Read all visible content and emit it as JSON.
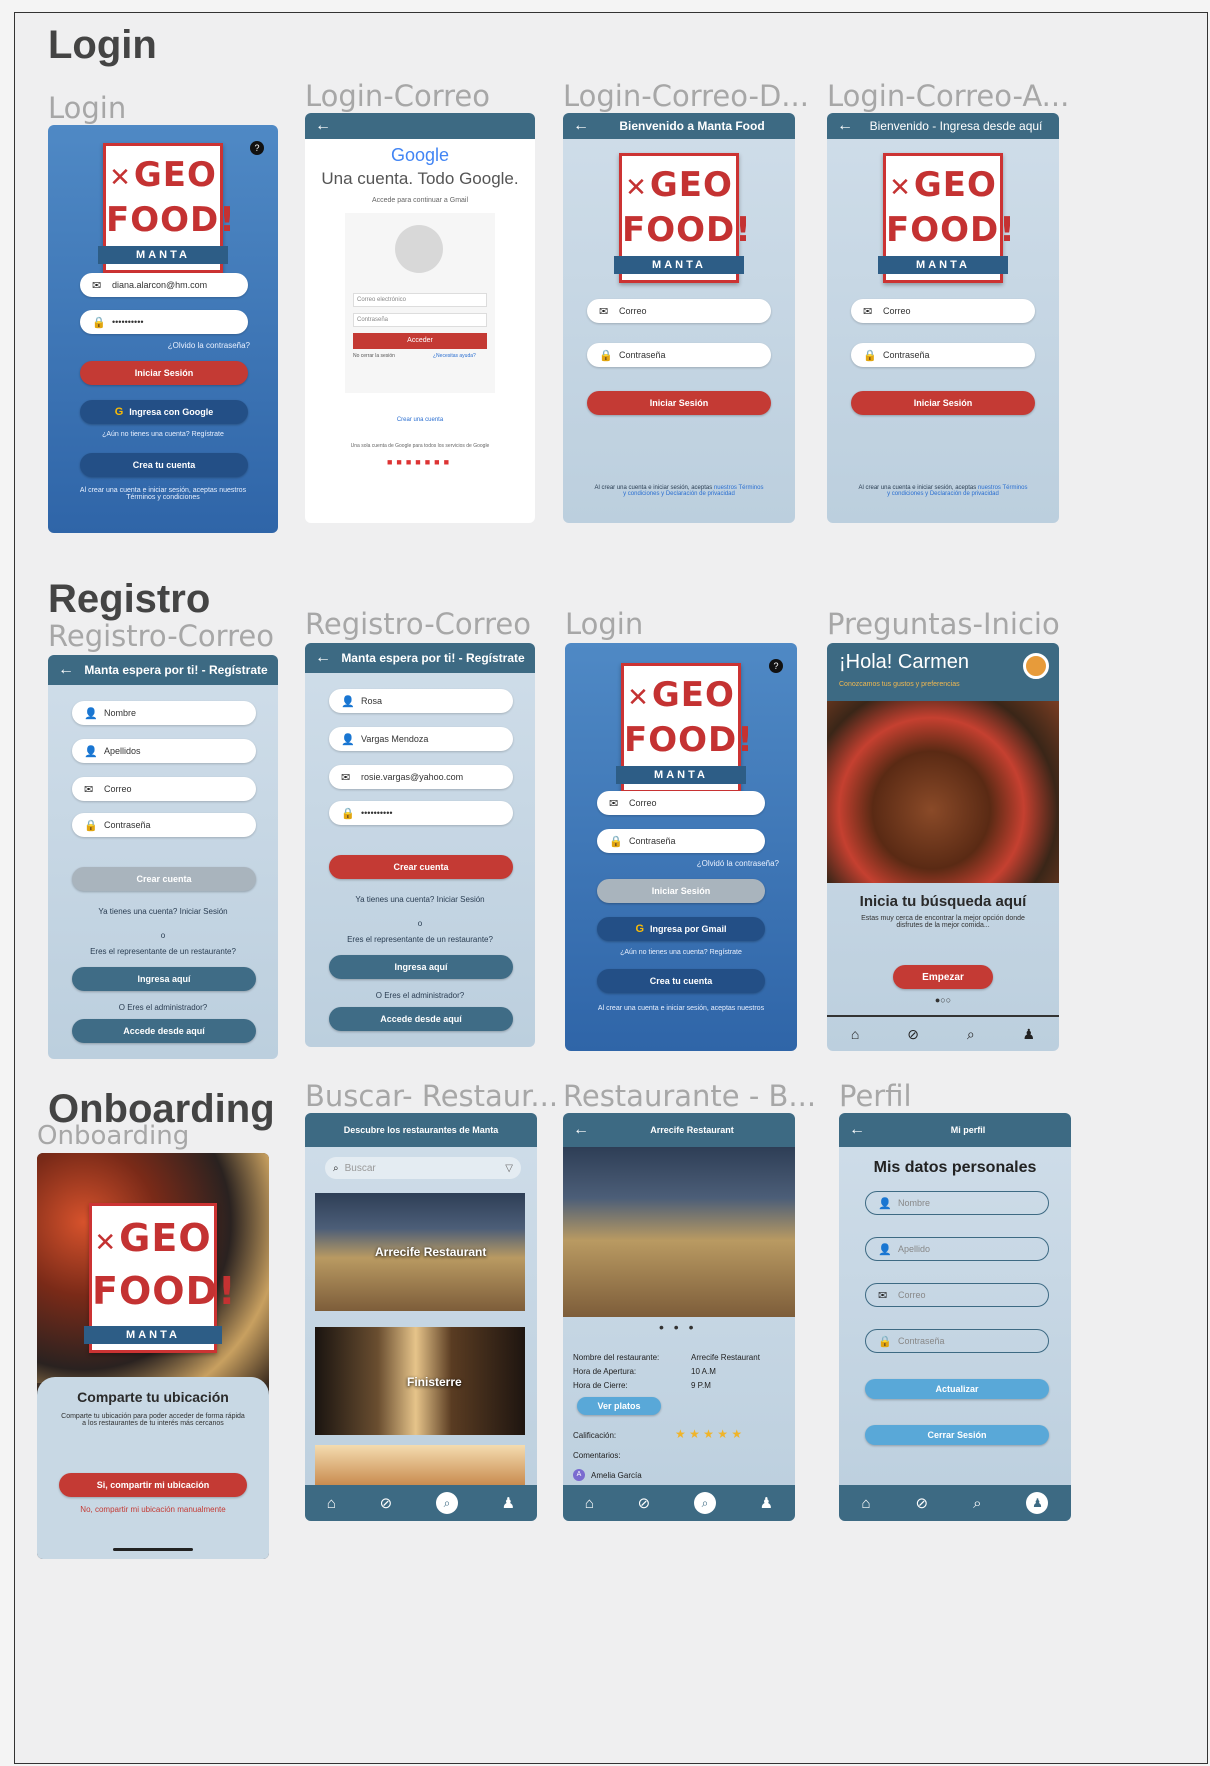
{
  "sections": {
    "login": "Login",
    "registro": "Registro",
    "onboarding": "Onboarding"
  },
  "frame_titles": {
    "login": "Login",
    "login_correo": "Login-Correo",
    "login_correo_d": "Login-Correo-D...",
    "login_correo_a": "Login-Correo-A...",
    "registro_correo_1": "Registro-Correo",
    "registro_correo_2": "Registro-Correo",
    "login_2": "Login",
    "preguntas": "Preguntas-Inicio",
    "onboarding": "Onboarding",
    "buscar": "Buscar- Restaur...",
    "restaurante": "Restaurante - B...",
    "perfil": "Perfil"
  },
  "logo": {
    "line1": "GEO",
    "line2": "FOOD!",
    "band": "MANTA"
  },
  "login1": {
    "email": "diana.alarcon@hm.com",
    "password": "••••••••••",
    "forgot": "¿Olvido la contraseña?",
    "signin": "Iniciar Sesión",
    "google": "Ingresa con Google",
    "register_hint": "¿Aún no tienes una cuenta? Regístrate",
    "create": "Crea tu cuenta",
    "terms": "Al crear una cuenta e iniciar sesión, aceptas nuestros Términos y condiciones"
  },
  "google": {
    "brand": "Google",
    "headline": "Una cuenta. Todo Google.",
    "sub": "Accede para continuar a Gmail",
    "email_ph": "Correo electrónico",
    "pass_ph": "Contraseña",
    "signin": "Acceder",
    "stay": "No cerrar la sesión",
    "help": "¿Necesitas ayuda?",
    "create": "Crear una cuenta",
    "footer": "Una sola cuenta de Google para todos los servicios de Google"
  },
  "login_d": {
    "header": "Bienvenido a Manta Food",
    "email_ph": "Correo",
    "pass_ph": "Contraseña",
    "signin": "Iniciar Sesión",
    "terms1": "Al crear una cuenta e iniciar sesión, aceptas",
    "terms2": "nuestros Términos",
    "terms3": "y condiciones y Declaración de privacidad"
  },
  "login_a": {
    "header": "Bienvenido - Ingresa desde aquí",
    "email_ph": "Correo",
    "pass_ph": "Contraseña",
    "signin": "Iniciar Sesión",
    "terms1": "Al crear una cuenta e iniciar sesión, aceptas",
    "terms2": "nuestros Términos",
    "terms3": "y condiciones y Declaración de privacidad"
  },
  "reg1": {
    "header": "Manta espera por ti! - Regístrate",
    "name_ph": "Nombre",
    "last_ph": "Apellidos",
    "email_ph": "Correo",
    "pass_ph": "Contraseña",
    "create": "Crear cuenta",
    "have": "Ya tienes una cuenta? Iniciar Sesión",
    "or": "o",
    "rep": "Eres el representante de un restaurante?",
    "enter": "Ingresa aquí",
    "admin": "O Eres el administrador?",
    "admin_btn": "Accede desde aquí"
  },
  "reg2": {
    "header": "Manta espera por ti! - Regístrate",
    "name": "Rosa",
    "last": "Vargas Mendoza",
    "email": "rosie.vargas@yahoo.com",
    "pass": "••••••••••",
    "create": "Crear cuenta",
    "have": "Ya tienes una cuenta? Iniciar Sesión",
    "or": "o",
    "rep": "Eres el representante de un restaurante?",
    "enter": "Ingresa aquí",
    "admin": "O Eres el administrador?",
    "admin_btn": "Accede desde aquí"
  },
  "login2": {
    "email_ph": "Correo",
    "pass_ph": "Contraseña",
    "forgot": "¿Olvidó la contraseña?",
    "signin": "Iniciar Sesión",
    "gmail": "Ingresa por Gmail",
    "register_hint": "¿Aún no tienes una cuenta? Regístrate",
    "create": "Crea tu cuenta",
    "terms": "Al crear una cuenta e iniciar sesión, aceptas nuestros"
  },
  "preguntas": {
    "hello": "¡Hola! Carmen",
    "sub": "Conozcamos tus gustos y preferencias",
    "title": "Inicia tu búsqueda aquí",
    "body": "Estas muy cerca de encontrar la mejor opción donde disfrutes de la mejor comida...",
    "start": "Empezar",
    "dots": "●○○"
  },
  "onboarding": {
    "title": "Comparte tu ubicación",
    "body": "Comparte tu ubicación para poder acceder de forma rápida a los restaurantes de tu interés más cercanos",
    "yes": "Si, compartir mi ubicación",
    "no": "No, compartir mi ubicación manualmente"
  },
  "buscar": {
    "header": "Descubre los restaurantes de Manta",
    "search_ph": "Buscar",
    "r1": "Arrecife Restaurant",
    "r2": "Finisterre"
  },
  "restaurante": {
    "header": "Arrecife Restaurant",
    "dots": "• • •",
    "k1": "Nombre del restaurante:",
    "v1": "Arrecife Restaurant",
    "k2": "Hora de Apertura:",
    "v2": "10 A.M",
    "k3": "Hora de Cierre:",
    "v3": "9 P.M",
    "dishes": "Ver platos",
    "rating": "Calificación:",
    "stars": "★ ★ ★ ★ ★",
    "comments": "Comentarios:",
    "commenter": "Amelia García"
  },
  "perfil": {
    "header": "Mi perfil",
    "title": "Mis datos personales",
    "name_ph": "Nombre",
    "last_ph": "Apellido",
    "email_ph": "Correo",
    "pass_ph": "Contraseña",
    "update": "Actualizar",
    "logout": "Cerrar Sesión"
  },
  "colors": {
    "header": "#3d6a83",
    "red": "#c43a34",
    "navy": "#234f86",
    "sky": "#59a8d8"
  }
}
